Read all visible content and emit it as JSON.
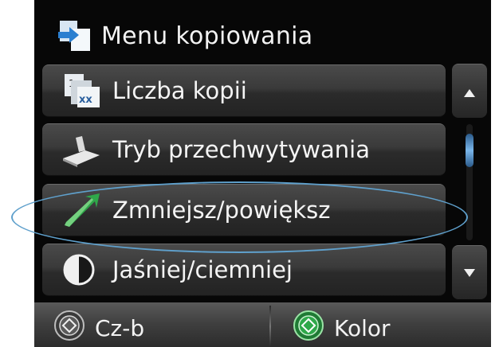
{
  "header": {
    "title": "Menu kopiowania",
    "icon": "copy-menu-icon"
  },
  "menu": {
    "items": [
      {
        "label": "Liczba kopii",
        "icon": "copies-icon"
      },
      {
        "label": "Tryb przechwytywania",
        "icon": "capture-mode-icon"
      },
      {
        "label": "Zmniejsz/powiększ",
        "icon": "resize-icon"
      },
      {
        "label": "Jaśniej/ciemniej",
        "icon": "contrast-icon"
      }
    ]
  },
  "scroll": {
    "up_icon": "arrow-up-icon",
    "down_icon": "arrow-down-icon"
  },
  "footer": {
    "mono_label": "Cz-b",
    "color_label": "Kolor"
  },
  "colors": {
    "highlight": "#5fa0cc",
    "start_green": "#2fa84a",
    "scroll_accent": "#7ab6ea"
  }
}
